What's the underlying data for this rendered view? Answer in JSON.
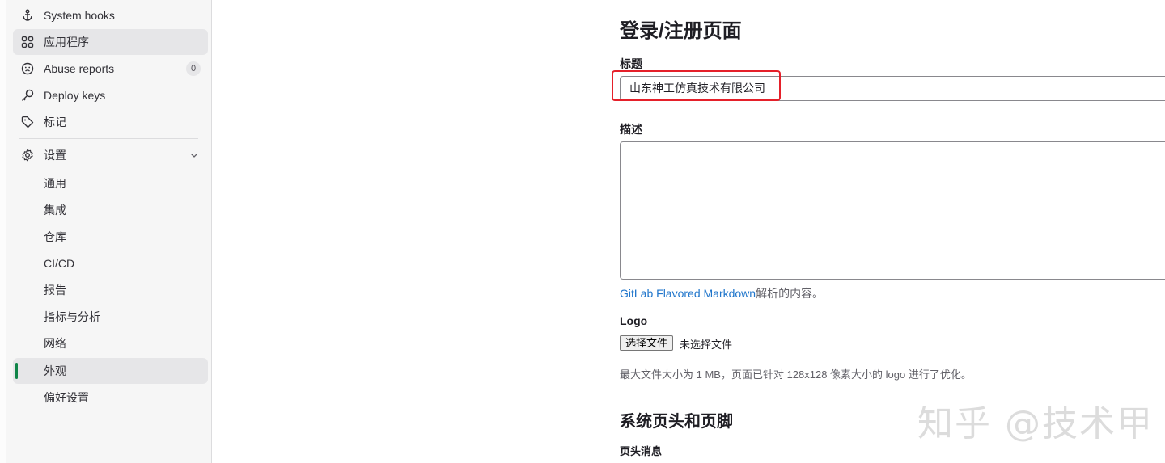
{
  "sidebar": {
    "items": [
      {
        "label": "System hooks",
        "icon": "anchor-icon"
      },
      {
        "label": "应用程序",
        "icon": "applications-icon"
      },
      {
        "label": "Abuse reports",
        "icon": "emoji-icon",
        "badge": "0"
      },
      {
        "label": "Deploy keys",
        "icon": "key-icon"
      },
      {
        "label": "标记",
        "icon": "tag-icon"
      }
    ],
    "settings": {
      "label": "设置",
      "icon": "gear-icon"
    },
    "sub_items": [
      "通用",
      "集成",
      "仓库",
      "CI/CD",
      "报告",
      "指标与分析",
      "网络",
      "外观",
      "偏好设置"
    ]
  },
  "main": {
    "section_title": "登录/注册页面",
    "title_label": "标题",
    "title_value": "山东神工仿真技术有限公司",
    "description_label": "描述",
    "markdown_link": "GitLab Flavored Markdown",
    "markdown_suffix": "解析的内容。",
    "logo_label": "Logo",
    "file_button": "选择文件",
    "file_status": "未选择文件",
    "logo_help": "最大文件大小为 1 MB，页面已针对 128x128 像素大小的 logo 进行了优化。",
    "header_footer_title": "系统页头和页脚",
    "header_message_label": "页头消息"
  },
  "watermark": "知乎 @技术甲",
  "colors": {
    "active_marker": "#108548",
    "highlight_border": "#e5202a",
    "link": "#1f75cb"
  }
}
